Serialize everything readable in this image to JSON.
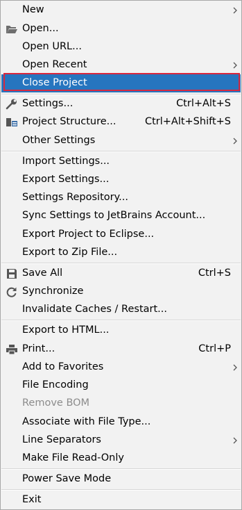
{
  "menu": {
    "items": {
      "new": {
        "label": "New"
      },
      "open": {
        "label": "Open..."
      },
      "open_url": {
        "label": "Open URL..."
      },
      "open_recent": {
        "label": "Open Recent"
      },
      "close_project": {
        "label": "Close Project"
      },
      "settings": {
        "label": "Settings...",
        "shortcut": "Ctrl+Alt+S"
      },
      "project_structure": {
        "label": "Project Structure...",
        "shortcut": "Ctrl+Alt+Shift+S"
      },
      "other_settings": {
        "label": "Other Settings"
      },
      "import_settings": {
        "label": "Import Settings..."
      },
      "export_settings": {
        "label": "Export Settings..."
      },
      "settings_repository": {
        "label": "Settings Repository..."
      },
      "sync_settings": {
        "label": "Sync Settings to JetBrains Account..."
      },
      "export_eclipse": {
        "label": "Export Project to Eclipse..."
      },
      "export_zip": {
        "label": "Export to Zip File..."
      },
      "save_all": {
        "label": "Save All",
        "shortcut": "Ctrl+S"
      },
      "synchronize": {
        "label": "Synchronize"
      },
      "invalidate_caches": {
        "label": "Invalidate Caches / Restart..."
      },
      "export_html": {
        "label": "Export to HTML..."
      },
      "print": {
        "label": "Print...",
        "shortcut": "Ctrl+P"
      },
      "add_favorites": {
        "label": "Add to Favorites"
      },
      "file_encoding": {
        "label": "File Encoding"
      },
      "remove_bom": {
        "label": "Remove BOM"
      },
      "associate_file_type": {
        "label": "Associate with File Type..."
      },
      "line_separators": {
        "label": "Line Separators"
      },
      "make_read_only": {
        "label": "Make File Read-Only"
      },
      "power_save": {
        "label": "Power Save Mode"
      },
      "exit": {
        "label": "Exit"
      }
    }
  },
  "colors": {
    "menu_background": "#f2f2f2",
    "highlight": "#2675bf",
    "highlight_outline": "#d8283f",
    "disabled_text": "#8c8c8c"
  }
}
